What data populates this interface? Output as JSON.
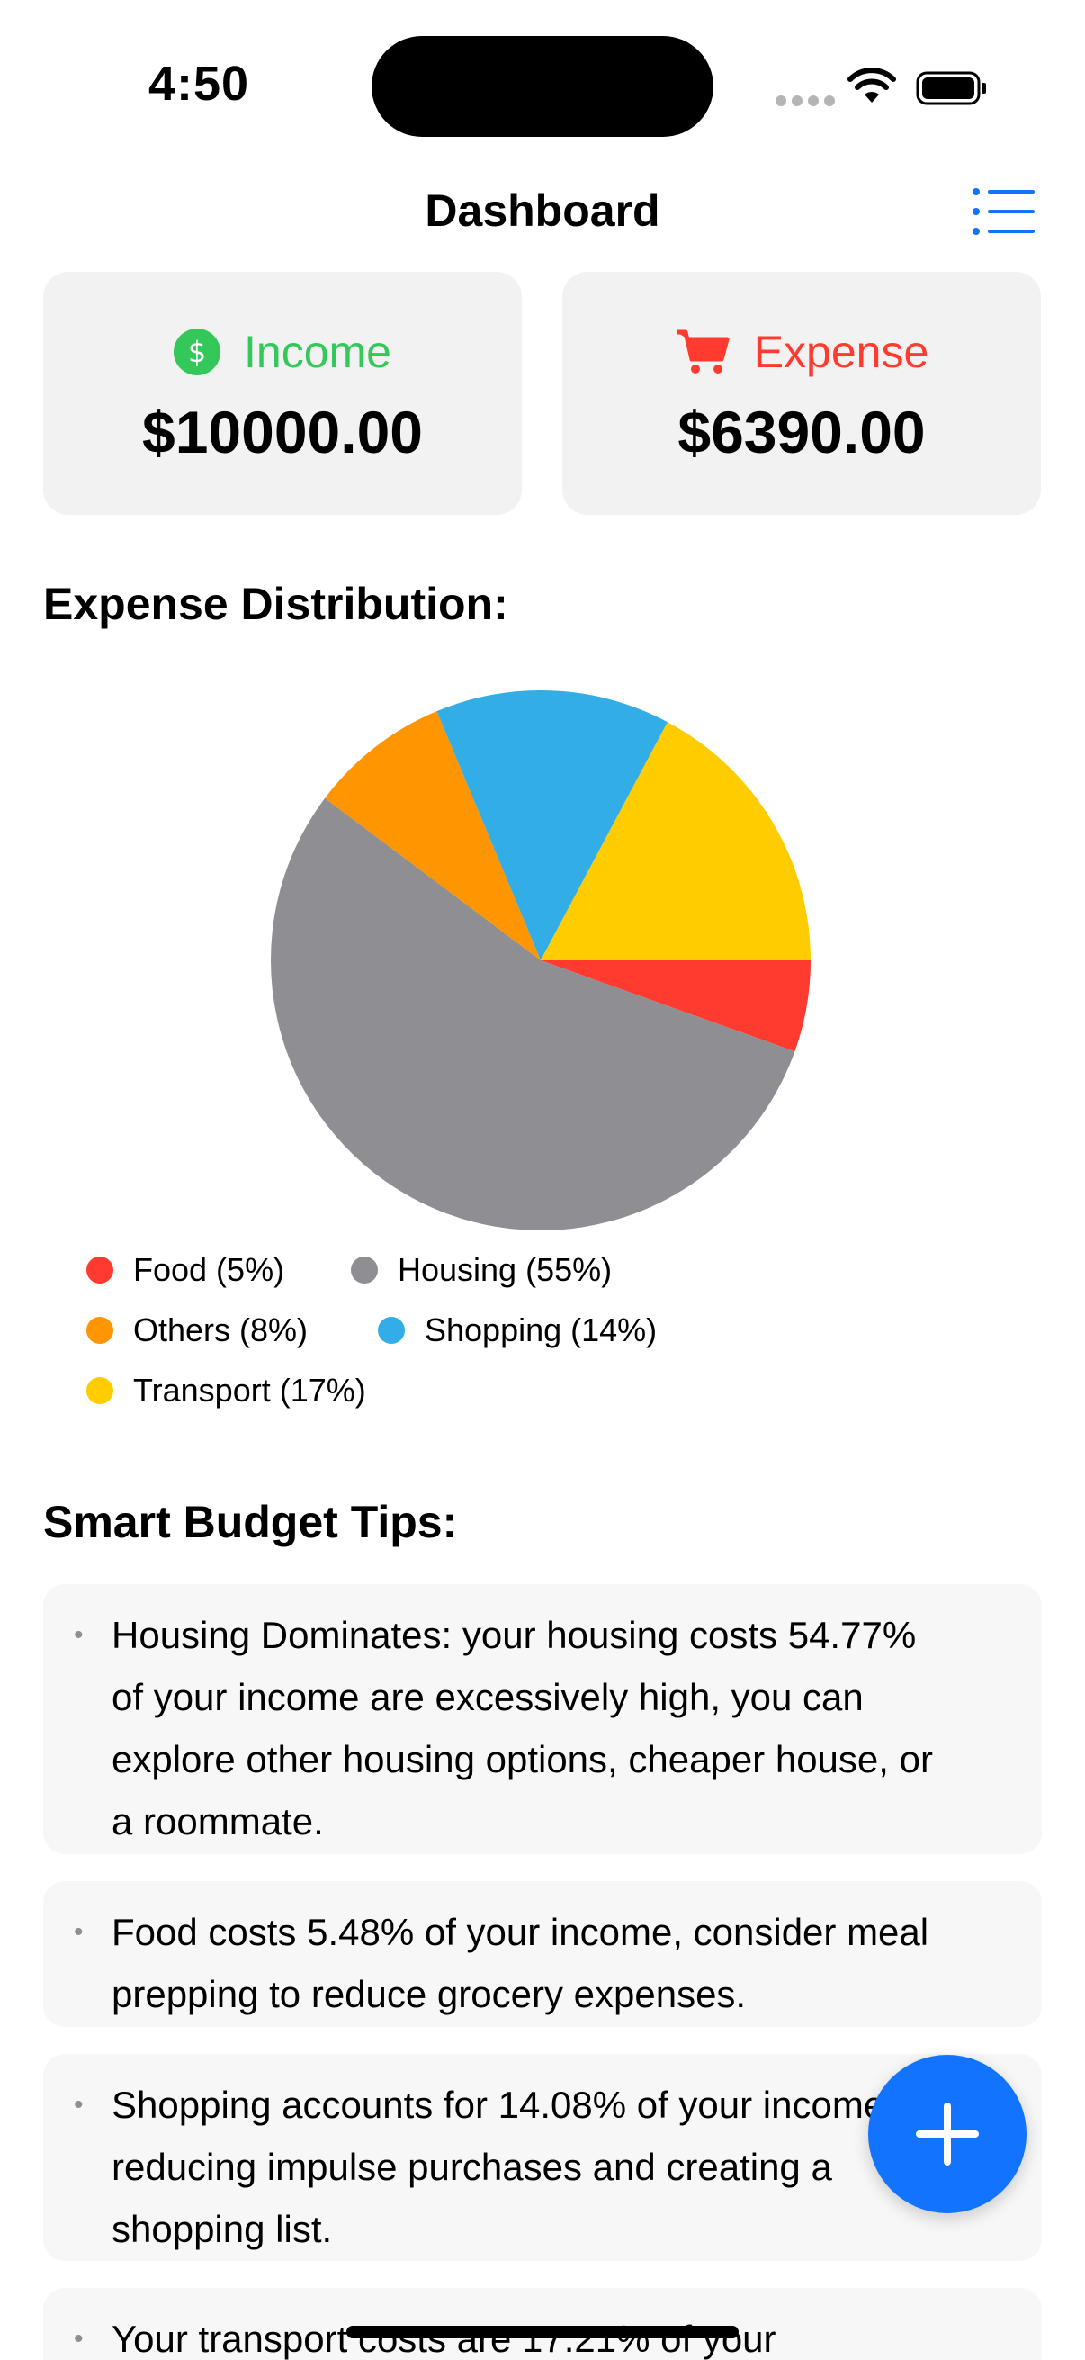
{
  "status_bar": {
    "time": "4:50"
  },
  "nav": {
    "title": "Dashboard",
    "menu_icon": "list-icon"
  },
  "summary": {
    "income": {
      "label": "Income",
      "amount": "$10000.00",
      "icon": "dollar-circle-icon",
      "color": "#34c759"
    },
    "expense": {
      "label": "Expense",
      "amount": "$6390.00",
      "icon": "cart-icon",
      "color": "#ff3b30"
    }
  },
  "distribution": {
    "title": "Expense Distribution:",
    "legend": [
      {
        "label": "Food (5%)",
        "color": "#ff3b30"
      },
      {
        "label": "Housing (55%)",
        "color": "#8e8e93"
      },
      {
        "label": "Others (8%)",
        "color": "#ff9500"
      },
      {
        "label": "Shopping (14%)",
        "color": "#32ade6"
      },
      {
        "label": "Transport (17%)",
        "color": "#ffcc00"
      }
    ]
  },
  "chart_data": {
    "type": "pie",
    "categories": [
      "Food",
      "Housing",
      "Others",
      "Shopping",
      "Transport"
    ],
    "values": [
      5.48,
      54.77,
      8.45,
      14.08,
      17.21
    ],
    "colors": [
      "#ff3b30",
      "#8e8e93",
      "#ff9500",
      "#32ade6",
      "#ffcc00"
    ],
    "legend_position": "bottom"
  },
  "tips": {
    "title": "Smart Budget Tips:",
    "items": [
      "Housing Dominates: your housing costs 54.77% of your income are excessively high, you can explore other housing options, cheaper house, or a roommate.",
      "Food costs 5.48% of your income, consider meal prepping to reduce grocery expenses.",
      "Shopping accounts for 14.08% of your income, try reducing impulse purchases and creating a shopping list.",
      "Your transport costs are 17.21% of your"
    ]
  },
  "fab": {
    "icon": "plus-icon"
  }
}
